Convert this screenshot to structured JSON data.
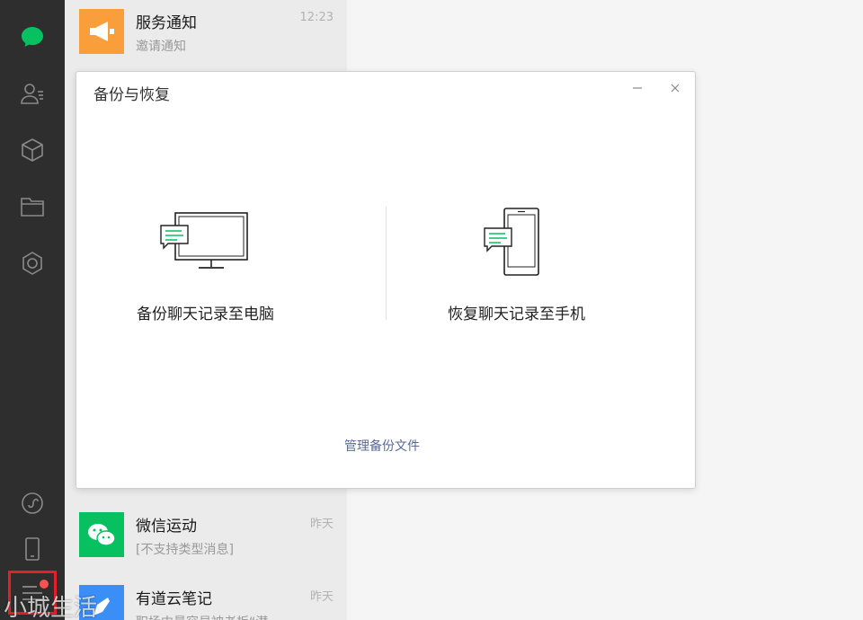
{
  "nav": {
    "items": [
      "chat-icon",
      "contacts-icon",
      "favorites-icon",
      "files-icon",
      "moments-icon"
    ],
    "bottom": [
      "mini-program-icon",
      "phone-icon",
      "menu-icon"
    ],
    "accent": "#07c160",
    "highlight_color": "#e3202a"
  },
  "chats": [
    {
      "name": "服务通知",
      "preview": "邀请通知",
      "time": "12:23",
      "icon": "megaphone-icon",
      "color": "#fa9d3b"
    },
    {
      "name": "微信运动",
      "preview": "[不支持类型消息]",
      "time": "昨天",
      "icon": "wechat-icon",
      "color": "#07c160"
    },
    {
      "name": "有道云笔记",
      "preview": "职场中最容易被老板“潜",
      "time": "昨天",
      "icon": "note-icon",
      "color": "#3a8ef6"
    }
  ],
  "dialog": {
    "title": "备份与恢复",
    "backup_label": "备份聊天记录至电脑",
    "restore_label": "恢复聊天记录至手机",
    "manage_link": "管理备份文件"
  },
  "watermark": "小城生活"
}
